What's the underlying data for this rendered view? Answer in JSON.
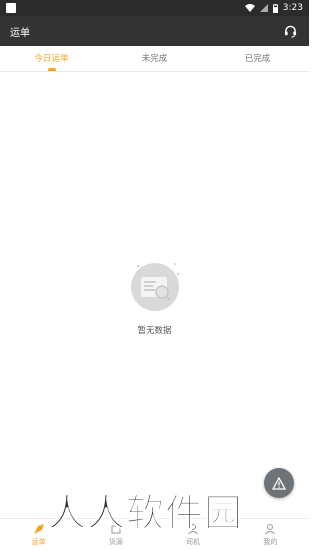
{
  "status_bar": {
    "time": "3:23"
  },
  "app_bar": {
    "title": "运单",
    "right_icon": "headset-icon"
  },
  "tabs": [
    {
      "label": "今日运单",
      "active": true
    },
    {
      "label": "未完成",
      "active": false
    },
    {
      "label": "已完成",
      "active": false
    }
  ],
  "empty_state": {
    "icon": "empty-document-icon",
    "text": "暂无数据"
  },
  "fab": {
    "icon": "warning-icon"
  },
  "bottom_nav": [
    {
      "label": "运单",
      "icon": "waybill-icon",
      "active": true
    },
    {
      "label": "货源",
      "icon": "cargo-icon",
      "active": false
    },
    {
      "label": "司机",
      "icon": "driver-icon",
      "active": false
    },
    {
      "label": "我的",
      "icon": "profile-icon",
      "active": false
    }
  ],
  "watermark": {
    "text": "人人软件园"
  },
  "colors": {
    "accent": "#f5a623",
    "appbar": "#333333",
    "statusbar": "#2b2b2b"
  }
}
